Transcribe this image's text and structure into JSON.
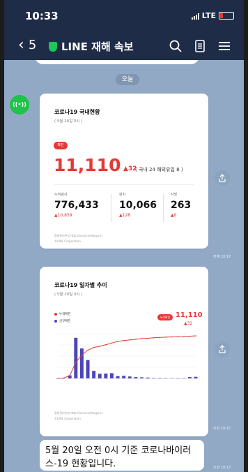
{
  "status": {
    "time": "10:33",
    "network": "LTE"
  },
  "header": {
    "back_count": "5",
    "title": "LINE 재해 속보"
  },
  "chat": {
    "date_label": "오늘",
    "avatar_text": "((•))",
    "card1": {
      "title": "코로나19 국내현황",
      "subtitle": "( 5월 20일 0시 )",
      "badge": "확진",
      "confirmed": "11,110",
      "confirmed_delta": "▲32",
      "confirmed_note": "( 국내 24 해외유입 8 )",
      "stats": [
        {
          "label": "누적검사",
          "value": "776,433",
          "delta": "▲10,859"
        },
        {
          "label": "완치",
          "value": "10,066",
          "delta": "▲128"
        },
        {
          "label": "사망",
          "value": "263",
          "delta": "▲0"
        }
      ],
      "source": "질병관리본부 http://ncov.mohw.go.kr",
      "copyright": "©LINE Corporation",
      "time": "어제 10:17"
    },
    "card2": {
      "title": "코로나19 일자별 추이",
      "subtitle": "( 5월 20일 0시 )",
      "legend": [
        "누적확진",
        "신규확진"
      ],
      "badge": "누적확진",
      "total": "11,110",
      "delta": "▲32",
      "source": "질병관리본부 http://ncov.mohw.go.kr",
      "copyright": "©LINE Corporation",
      "time": "오전 10:17"
    },
    "text_message": "5월 20일 오전 0시 기준 코로나바이러스-19 현황입니다.",
    "text_time": "오전 10:17",
    "colors": {
      "red": "#e53935",
      "blue": "#4a45b8",
      "bg": "#91a9c5"
    }
  },
  "chart_data": {
    "type": "line",
    "series": [
      {
        "name": "누적확진",
        "values": [
          30,
          104,
          763,
          4212,
          6088,
          7382,
          8086,
          8413,
          8799,
          9241,
          9661,
          9887,
          10062,
          10237,
          10384,
          10480,
          10613,
          10702,
          10780,
          10840,
          10874,
          10909,
          11018,
          11110
        ]
      },
      {
        "name": "신규확진",
        "values": [
          0,
          2,
          60,
          813,
          600,
          367,
          152,
          93,
          98,
          105,
          47,
          53,
          39,
          27,
          22,
          18,
          11,
          10,
          9,
          6,
          3,
          2,
          27,
          32
        ]
      }
    ],
    "title": "코로나19 일자별 추이"
  }
}
